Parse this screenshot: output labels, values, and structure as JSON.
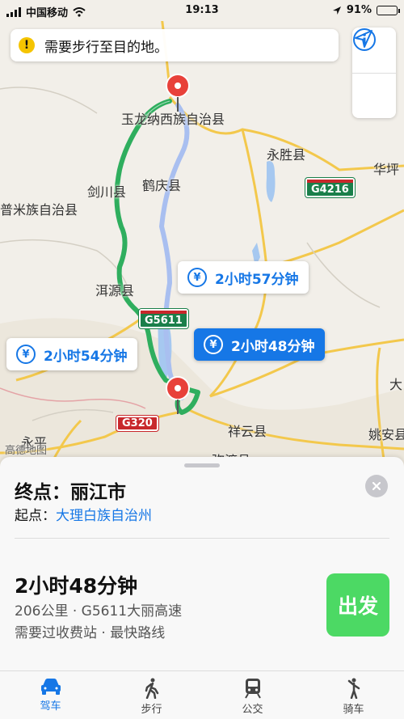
{
  "status_bar": {
    "carrier": "中国移动",
    "time": "19:13",
    "battery": "91%",
    "battery_level": 0.91
  },
  "banner": {
    "icon": "warning-icon",
    "text": "需要步行至目的地。"
  },
  "map": {
    "labels": {
      "yulong": "玉龙纳西族自治县",
      "yongsheng": "永胜县",
      "huaping": "华坪",
      "jianchuan": "剑川县",
      "heqing": "鹤庆县",
      "lanping": "普米族自治县",
      "eryuan": "洱源县",
      "xiangyun": "祥云县",
      "yaoan": "姚安县",
      "yongping": "永平",
      "da": "大",
      "bottom": "弥渡县",
      "attribution": "高德地图"
    },
    "shields": {
      "g4216": "G4216",
      "g5611": "G5611",
      "g320": "G320"
    },
    "routes": [
      {
        "currency": "¥",
        "time": "2小时57分钟",
        "selected": false
      },
      {
        "currency": "¥",
        "time": "2小时54分钟",
        "selected": false
      },
      {
        "currency": "¥",
        "time": "2小时48分钟",
        "selected": true
      }
    ],
    "colors": {
      "selected_route": "#2fae5e",
      "alt_route": "#a9bff0",
      "roads": "#f3c84c",
      "water": "#a6c8f0",
      "pin": "#e8413a"
    },
    "buttons": {
      "info": "info-icon",
      "locate": "location-arrow-icon"
    }
  },
  "sheet": {
    "destination_label": "终点：",
    "destination": "丽江市",
    "origin_label": "起点：",
    "origin": "大理白族自治州",
    "duration": "2小时48分钟",
    "detail_line1": "206公里 · G5611大丽高速",
    "detail_line2": "需要过收费站 · 最快路线",
    "go": "出发"
  },
  "tabs": [
    {
      "label": "驾车",
      "icon": "car-icon",
      "active": true
    },
    {
      "label": "步行",
      "icon": "walk-icon",
      "active": false
    },
    {
      "label": "公交",
      "icon": "transit-icon",
      "active": false
    },
    {
      "label": "骑车",
      "icon": "hail-icon",
      "active": false
    }
  ]
}
